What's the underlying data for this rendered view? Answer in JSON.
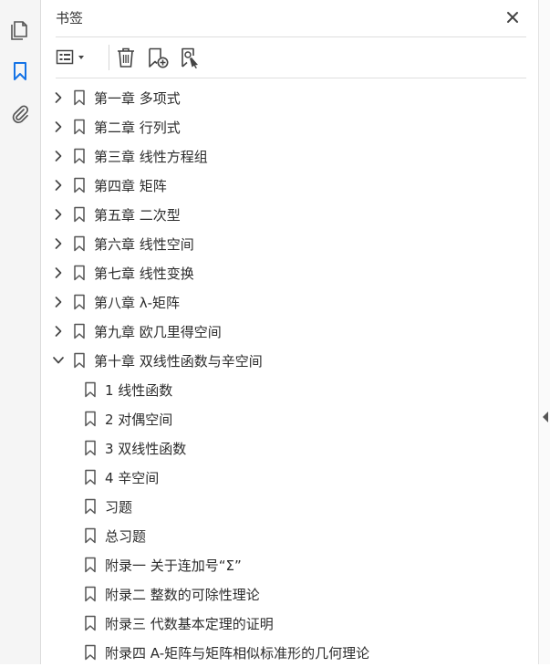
{
  "rail": {
    "pages_icon": "pages-icon",
    "bookmarks_icon": "bookmark-icon",
    "attachments_icon": "paperclip-icon",
    "accent": "#1473e6"
  },
  "panel": {
    "title": "书签",
    "close_icon": "close-icon"
  },
  "toolbar": {
    "options_icon": "list-options-icon",
    "delete_icon": "trash-icon",
    "new_bookmark_icon": "new-bookmark-icon",
    "find_bookmark_icon": "find-current-bookmark-icon"
  },
  "bookmarks": [
    {
      "label": "第一章  多项式",
      "level": 0,
      "expandable": true,
      "expanded": false
    },
    {
      "label": "第二章  行列式",
      "level": 0,
      "expandable": true,
      "expanded": false
    },
    {
      "label": "第三章  线性方程组",
      "level": 0,
      "expandable": true,
      "expanded": false
    },
    {
      "label": "第四章  矩阵",
      "level": 0,
      "expandable": true,
      "expanded": false
    },
    {
      "label": "第五章  二次型",
      "level": 0,
      "expandable": true,
      "expanded": false
    },
    {
      "label": "第六章  线性空间",
      "level": 0,
      "expandable": true,
      "expanded": false
    },
    {
      "label": "第七章  线性变换",
      "level": 0,
      "expandable": true,
      "expanded": false
    },
    {
      "label": "第八章  λ-矩阵",
      "level": 0,
      "expandable": true,
      "expanded": false
    },
    {
      "label": "第九章  欧几里得空间",
      "level": 0,
      "expandable": true,
      "expanded": false
    },
    {
      "label": "第十章  双线性函数与辛空间",
      "level": 0,
      "expandable": true,
      "expanded": true
    },
    {
      "label": "1  线性函数",
      "level": 1,
      "expandable": false,
      "expanded": false
    },
    {
      "label": "2  对偶空间",
      "level": 1,
      "expandable": false,
      "expanded": false
    },
    {
      "label": "3  双线性函数",
      "level": 1,
      "expandable": false,
      "expanded": false
    },
    {
      "label": "4  辛空间",
      "level": 1,
      "expandable": false,
      "expanded": false
    },
    {
      "label": "习题",
      "level": 1,
      "expandable": false,
      "expanded": false
    },
    {
      "label": "总习题",
      "level": 1,
      "expandable": false,
      "expanded": false
    },
    {
      "label": "附录一  关于连加号“Σ”",
      "level": 1,
      "expandable": false,
      "expanded": false
    },
    {
      "label": "附录二  整数的可除性理论",
      "level": 1,
      "expandable": false,
      "expanded": false
    },
    {
      "label": "附录三  代数基本定理的证明",
      "level": 1,
      "expandable": false,
      "expanded": false
    },
    {
      "label": "附录四  A-矩阵与矩阵相似标准形的几何理论",
      "level": 1,
      "expandable": false,
      "expanded": false
    }
  ]
}
